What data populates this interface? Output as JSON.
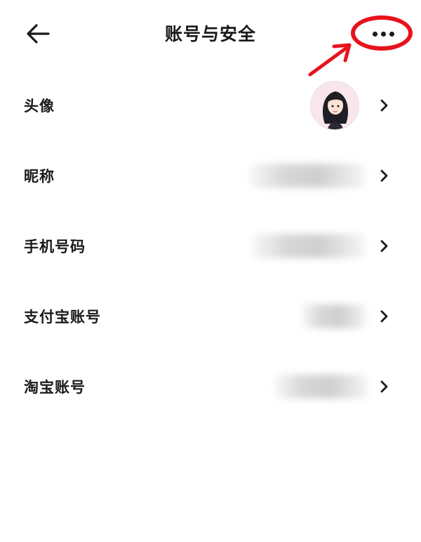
{
  "header": {
    "title": "账号与安全",
    "back_icon": "arrow-left-icon",
    "more_icon": "more-horizontal-icon"
  },
  "annotation": {
    "color": "#e8121c"
  },
  "rows": [
    {
      "label": "头像",
      "value_type": "avatar"
    },
    {
      "label": "昵称",
      "value_type": "obscured"
    },
    {
      "label": "手机号码",
      "value_type": "obscured"
    },
    {
      "label": "支付宝账号",
      "value_type": "obscured"
    },
    {
      "label": "淘宝账号",
      "value_type": "obscured"
    }
  ],
  "colors": {
    "text": "#1a1a1a",
    "background": "#ffffff"
  }
}
